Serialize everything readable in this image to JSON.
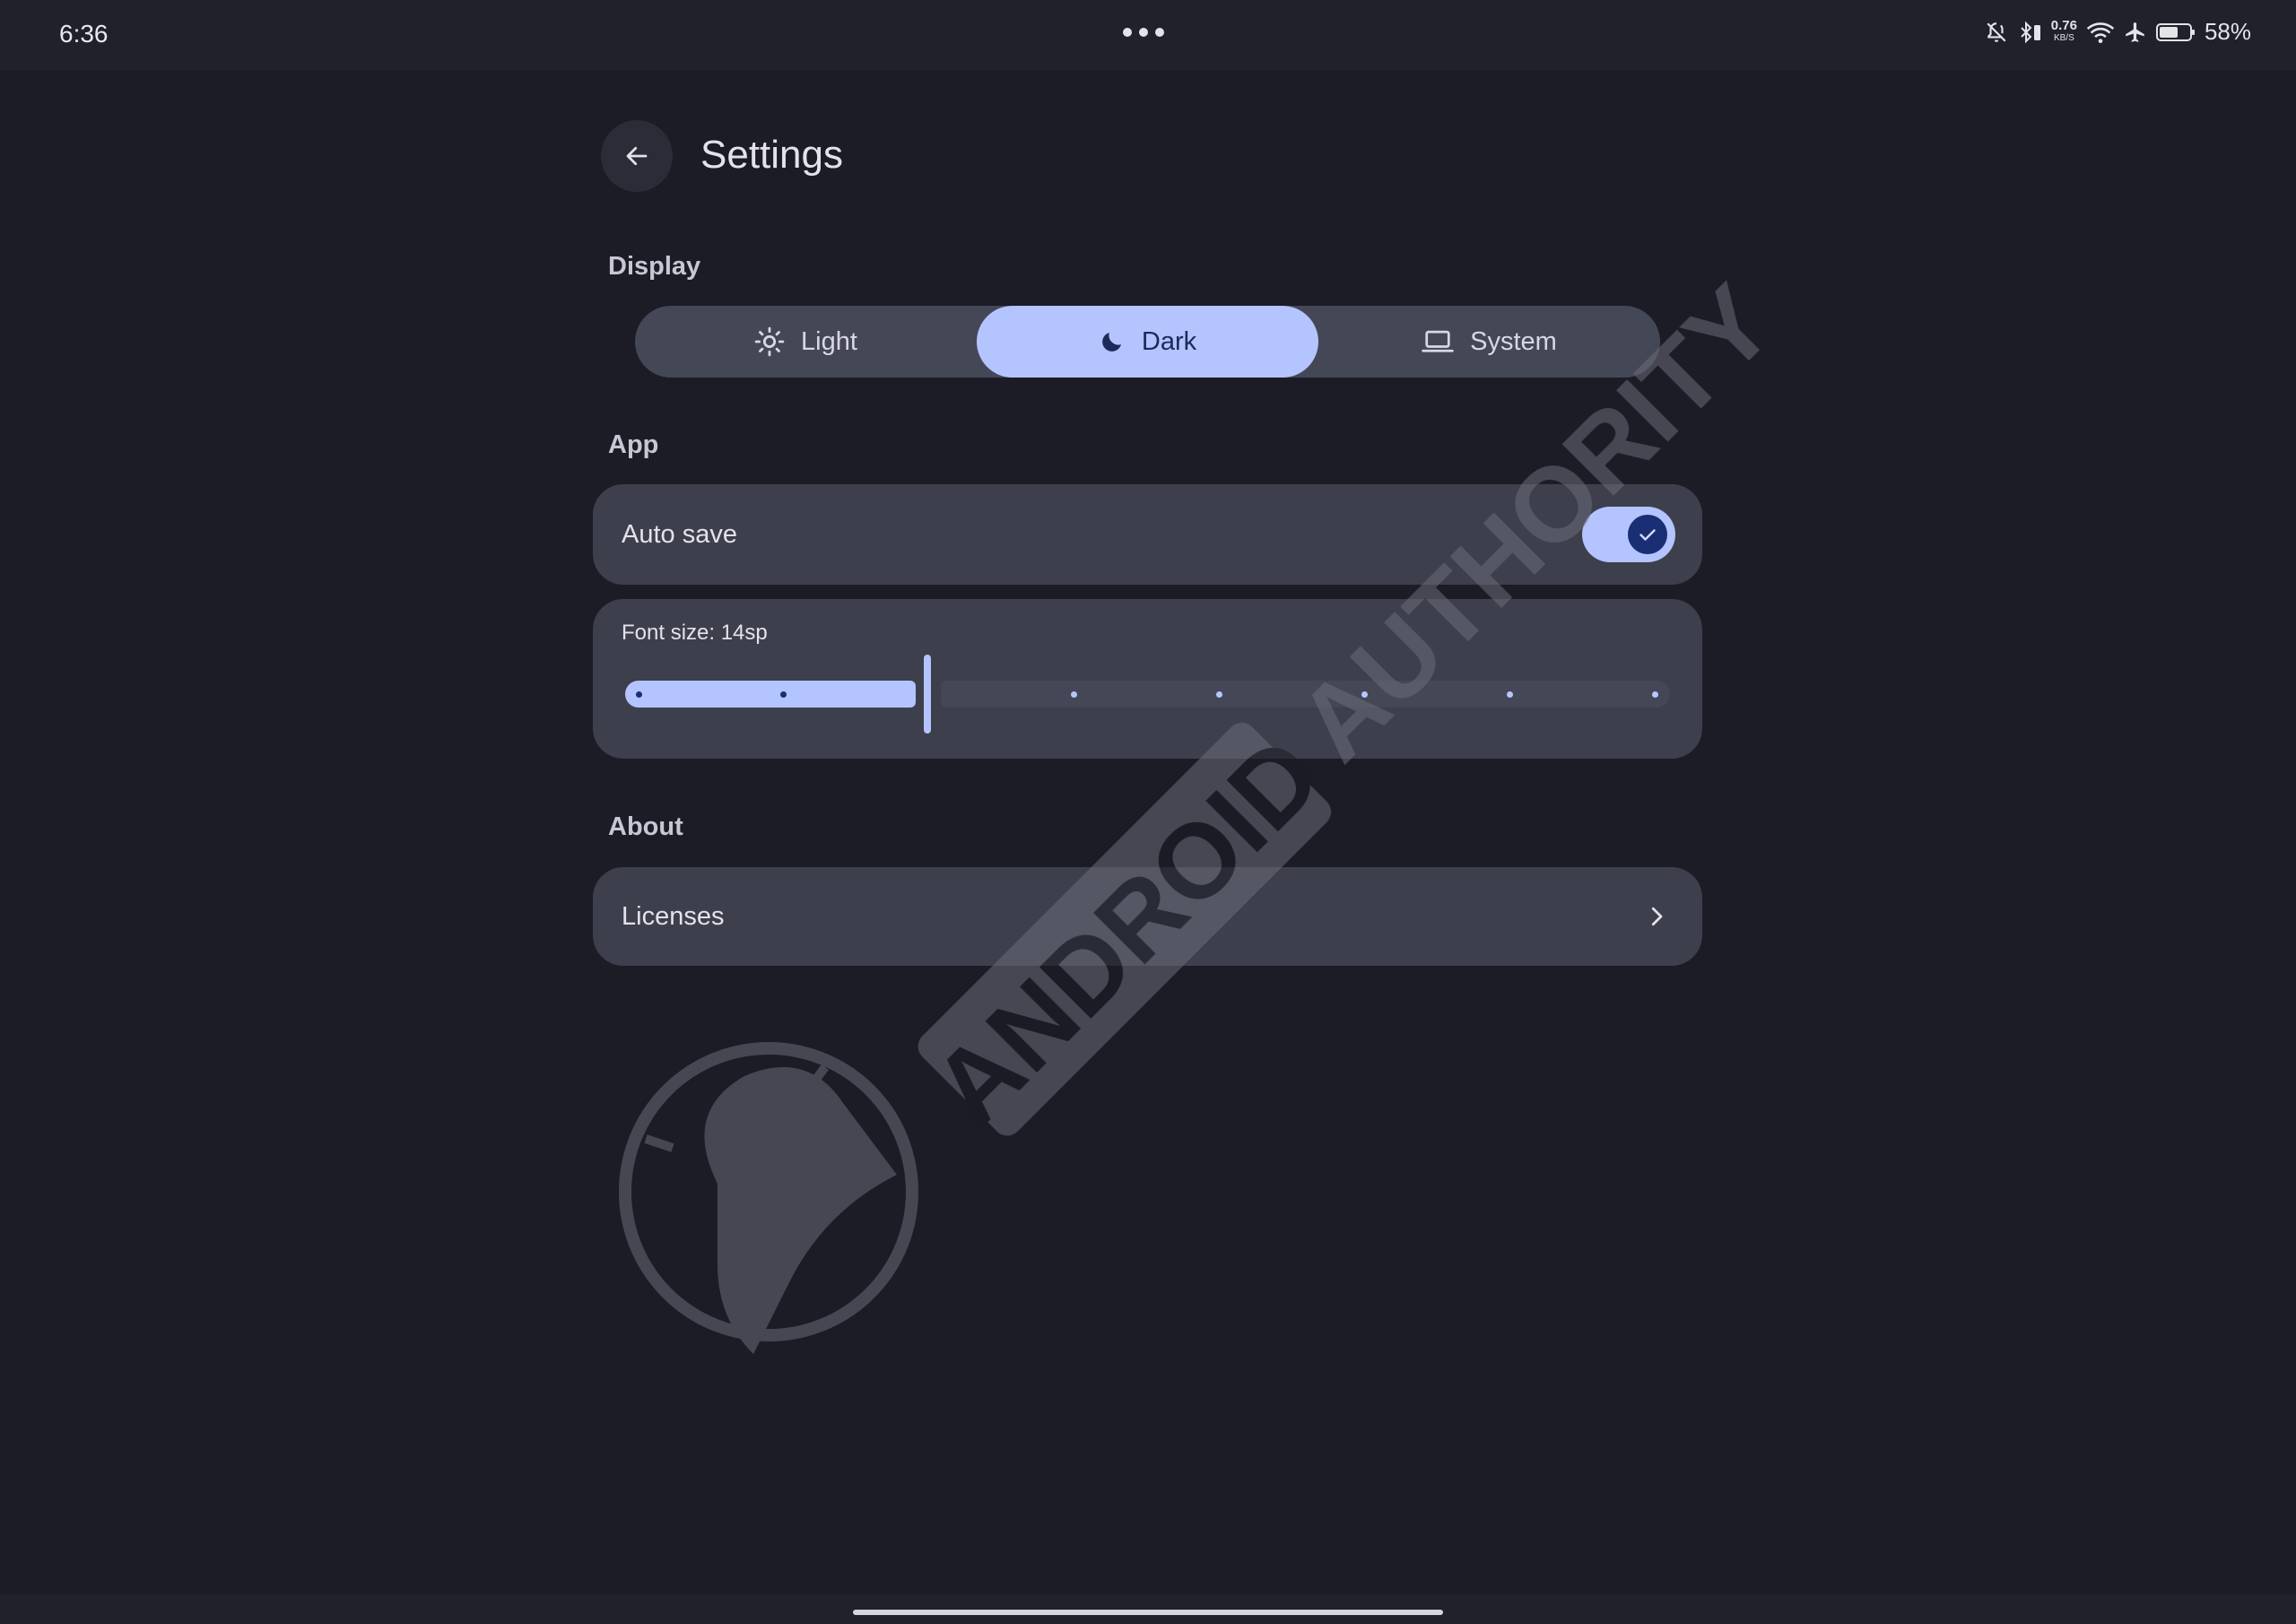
{
  "status_bar": {
    "time": "6:36",
    "net_speed_value": "0.76",
    "net_speed_unit": "KB/S",
    "battery": "58%",
    "icons": [
      "bell-off-icon",
      "bluetooth-battery-icon",
      "wifi-icon",
      "airplane-icon",
      "battery-icon"
    ]
  },
  "header": {
    "title": "Settings",
    "back_icon": "arrow-left-icon"
  },
  "display": {
    "section_label": "Display",
    "theme_options": [
      {
        "label": "Light",
        "icon": "sun-icon",
        "selected": false
      },
      {
        "label": "Dark",
        "icon": "moon-icon",
        "selected": true
      },
      {
        "label": "System",
        "icon": "laptop-icon",
        "selected": false
      }
    ]
  },
  "app": {
    "section_label": "App",
    "auto_save": {
      "label": "Auto save",
      "enabled": true
    },
    "font_size": {
      "label": "Font size: 14sp",
      "selected_step": 2,
      "total_steps": 8
    }
  },
  "about": {
    "section_label": "About",
    "licenses_label": "Licenses",
    "licenses_icon": "chevron-right-icon"
  },
  "watermark": {
    "text": "ANDROID AUTHORITY"
  },
  "colors": {
    "background": "#1b1c26",
    "card": "#3d3f4c",
    "accent": "#b4c4ff",
    "accent_dark": "#1a2f73"
  }
}
